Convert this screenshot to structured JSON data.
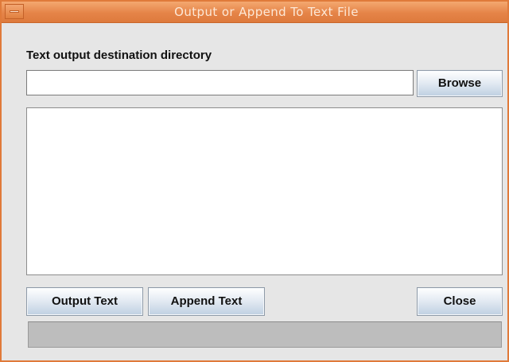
{
  "window": {
    "title": "Output or Append To Text File"
  },
  "destination": {
    "label": "Text output destination directory",
    "value": "",
    "browse_label": "Browse"
  },
  "text_area": {
    "value": ""
  },
  "actions": {
    "output_label": "Output Text",
    "append_label": "Append Text",
    "close_label": "Close"
  },
  "status": {
    "text": ""
  },
  "colors": {
    "titlebar": "#e58448",
    "window_border": "#e07a3a",
    "background": "#e6e6e6",
    "status_bar": "#bdbdbd"
  },
  "icons": {
    "window_menu": "minus-icon"
  }
}
